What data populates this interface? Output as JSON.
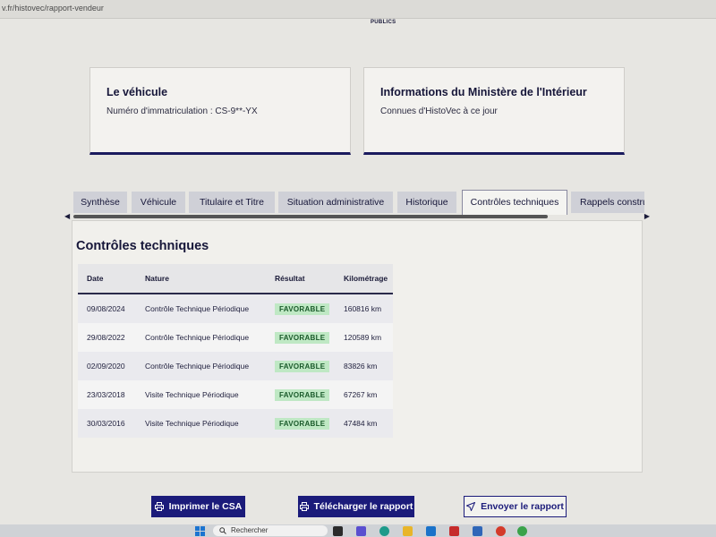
{
  "browser": {
    "url": "v.fr/histovec/rapport-vendeur"
  },
  "logo": {
    "text": "PUBLICS"
  },
  "vehicle_card": {
    "title": "Le véhicule",
    "plate": "Numéro d'immatriculation : CS-9**-YX"
  },
  "ministry_card": {
    "title": "Informations du Ministère de l'Intérieur",
    "subtitle": "Connues d'HistoVec à ce jour"
  },
  "tabs": [
    {
      "label": "Synthèse"
    },
    {
      "label": "Véhicule"
    },
    {
      "label": "Titulaire et Titre"
    },
    {
      "label": "Situation administrative"
    },
    {
      "label": "Historique"
    },
    {
      "label": "Contrôles techniques"
    },
    {
      "label": "Rappels constructeur"
    }
  ],
  "section": {
    "title": "Contrôles techniques",
    "columns": [
      "Date",
      "Nature",
      "Résultat",
      "Kilométrage"
    ],
    "rows": [
      {
        "date": "09/08/2024",
        "nature": "Contrôle Technique Périodique",
        "result": "FAVORABLE",
        "km": "160816 km"
      },
      {
        "date": "29/08/2022",
        "nature": "Contrôle Technique Périodique",
        "result": "FAVORABLE",
        "km": "120589 km"
      },
      {
        "date": "02/09/2020",
        "nature": "Contrôle Technique Périodique",
        "result": "FAVORABLE",
        "km": "83826 km"
      },
      {
        "date": "23/03/2018",
        "nature": "Visite Technique Périodique",
        "result": "FAVORABLE",
        "km": "67267 km"
      },
      {
        "date": "30/03/2016",
        "nature": "Visite Technique Périodique",
        "result": "FAVORABLE",
        "km": "47484 km"
      }
    ]
  },
  "actions": {
    "print_csa": "Imprimer le CSA",
    "download_report": "Télécharger le rapport",
    "send_report": "Envoyer le rapport"
  },
  "taskbar": {
    "search_placeholder": "Rechercher"
  },
  "icons": {
    "print": "printer-icon",
    "send": "paper-plane-icon",
    "windows": "windows-start-icon",
    "search": "magnifier-icon"
  },
  "colors": {
    "primary": "#1b1b7a",
    "badge_bg": "#bfe8c4",
    "badge_text": "#1a5a2a",
    "tab_bg": "#cfd0d7"
  }
}
